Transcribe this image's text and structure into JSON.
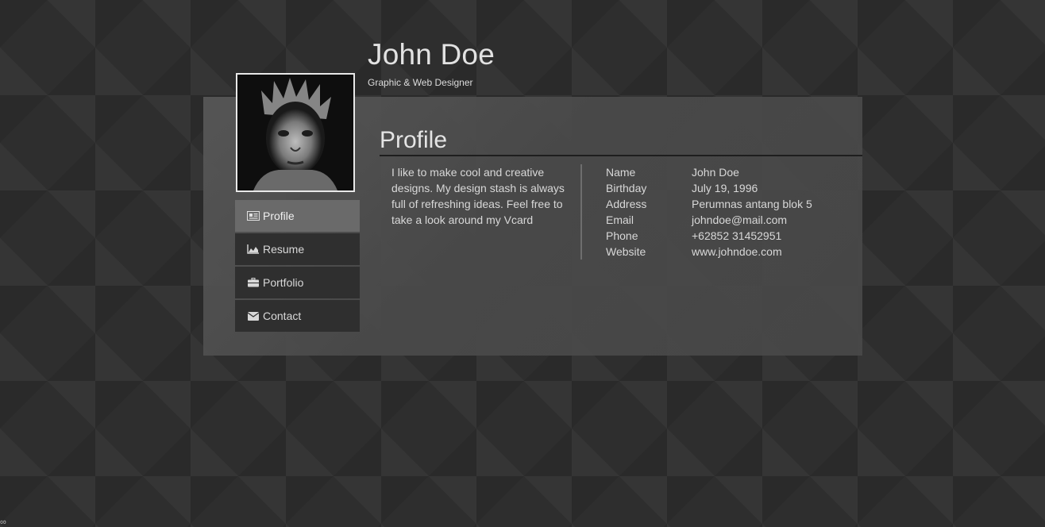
{
  "header": {
    "name": "John Doe",
    "role": "Graphic & Web Designer"
  },
  "nav": {
    "items": [
      {
        "label": "Profile",
        "icon": "newspaper-icon",
        "active": true
      },
      {
        "label": "Resume",
        "icon": "area-chart-icon",
        "active": false
      },
      {
        "label": "Portfolio",
        "icon": "briefcase-icon",
        "active": false
      },
      {
        "label": "Contact",
        "icon": "envelope-icon",
        "active": false
      }
    ]
  },
  "profile": {
    "title": "Profile",
    "bio": "I like to make cool and creative designs. My design stash is always full of refreshing ideas. Feel free to take a look around my Vcard",
    "info": [
      {
        "label": "Name",
        "value": "John Doe"
      },
      {
        "label": "Birthday",
        "value": "July 19, 1996"
      },
      {
        "label": "Address",
        "value": "Perumnas antang blok 5"
      },
      {
        "label": "Email",
        "value": "johndoe@mail.com"
      },
      {
        "label": "Phone",
        "value": "+62852 31452951"
      },
      {
        "label": "Website",
        "value": "www.johndoe.com"
      }
    ]
  },
  "corner_text": "∞",
  "colors": {
    "background": "#2e2e2e",
    "panel": "#4f4f4f",
    "nav_active": "#6a6a6a",
    "nav_item": "#2f2f2f",
    "text": "#dcdcdc"
  }
}
